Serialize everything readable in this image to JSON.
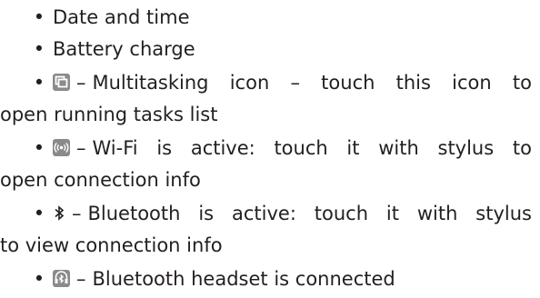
{
  "list": {
    "item1": "Date and time",
    "item2": "Battery charge",
    "item3": {
      "sep": "–",
      "line1": [
        "Multitasking",
        "icon",
        "–",
        "touch",
        "this",
        "icon",
        "to"
      ],
      "line2": "open running tasks list",
      "icon": "multitasking-icon"
    },
    "item4": {
      "sep": "–",
      "line1": [
        "Wi-Fi",
        "is",
        "active:",
        "touch",
        "it",
        "with",
        "stylus",
        "to"
      ],
      "line2": "open connection info",
      "icon": "wifi-icon"
    },
    "item5": {
      "sep": "–",
      "line1": [
        "Bluetooth",
        "is",
        "active:",
        "touch",
        "it",
        "with",
        "stylus"
      ],
      "line2": "to view connection info",
      "icon": "bluetooth-icon"
    },
    "item6": {
      "sep": "–",
      "text": "Bluetooth headset is connected",
      "icon": "bluetooth-headset-icon"
    }
  },
  "colors": {
    "text": "#231f20",
    "icon_bg": "#8a8a8a",
    "icon_fg": "#ffffff"
  }
}
